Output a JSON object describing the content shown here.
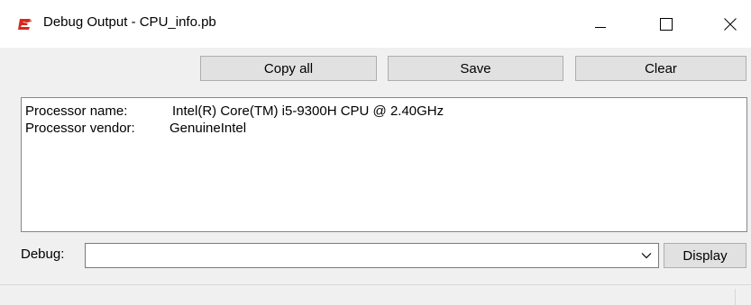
{
  "window": {
    "title": "Debug Output - CPU_info.pb",
    "app_icon": "purebasic-logo-icon",
    "controls": {
      "minimize": "minimize-icon",
      "maximize": "maximize-icon",
      "close": "close-icon"
    }
  },
  "toolbar": {
    "copy_all_label": "Copy all",
    "save_label": "Save",
    "clear_label": "Clear"
  },
  "output": {
    "lines": [
      {
        "label": "Processor name:",
        "value": "Intel(R) Core(TM) i5-9300H CPU @ 2.40GHz"
      },
      {
        "label": "Processor vendor:",
        "value": "GenuineIntel"
      }
    ]
  },
  "debug": {
    "label": "Debug:",
    "input_value": "",
    "dropdown_icon": "chevron-down-icon",
    "display_label": "Display"
  },
  "colors": {
    "button_face": "#e1e1e1",
    "window_bg": "#f0f0f0",
    "app_icon_red": "#d9261c"
  }
}
